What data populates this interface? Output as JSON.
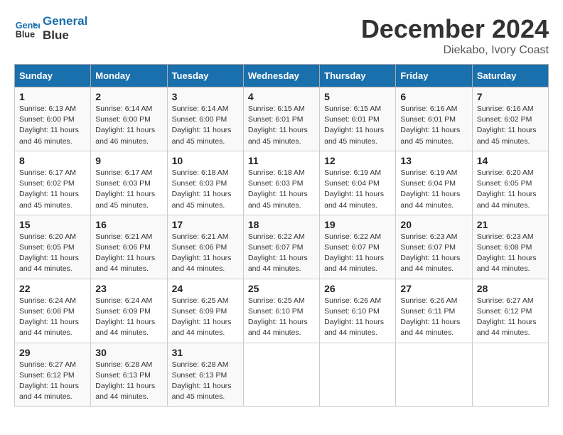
{
  "header": {
    "logo_line1": "General",
    "logo_line2": "Blue",
    "main_title": "December 2024",
    "subtitle": "Diekabo, Ivory Coast"
  },
  "days_of_week": [
    "Sunday",
    "Monday",
    "Tuesday",
    "Wednesday",
    "Thursday",
    "Friday",
    "Saturday"
  ],
  "weeks": [
    [
      {
        "day": "1",
        "info": "Sunrise: 6:13 AM\nSunset: 6:00 PM\nDaylight: 11 hours\nand 46 minutes."
      },
      {
        "day": "2",
        "info": "Sunrise: 6:14 AM\nSunset: 6:00 PM\nDaylight: 11 hours\nand 46 minutes."
      },
      {
        "day": "3",
        "info": "Sunrise: 6:14 AM\nSunset: 6:00 PM\nDaylight: 11 hours\nand 45 minutes."
      },
      {
        "day": "4",
        "info": "Sunrise: 6:15 AM\nSunset: 6:01 PM\nDaylight: 11 hours\nand 45 minutes."
      },
      {
        "day": "5",
        "info": "Sunrise: 6:15 AM\nSunset: 6:01 PM\nDaylight: 11 hours\nand 45 minutes."
      },
      {
        "day": "6",
        "info": "Sunrise: 6:16 AM\nSunset: 6:01 PM\nDaylight: 11 hours\nand 45 minutes."
      },
      {
        "day": "7",
        "info": "Sunrise: 6:16 AM\nSunset: 6:02 PM\nDaylight: 11 hours\nand 45 minutes."
      }
    ],
    [
      {
        "day": "8",
        "info": "Sunrise: 6:17 AM\nSunset: 6:02 PM\nDaylight: 11 hours\nand 45 minutes."
      },
      {
        "day": "9",
        "info": "Sunrise: 6:17 AM\nSunset: 6:03 PM\nDaylight: 11 hours\nand 45 minutes."
      },
      {
        "day": "10",
        "info": "Sunrise: 6:18 AM\nSunset: 6:03 PM\nDaylight: 11 hours\nand 45 minutes."
      },
      {
        "day": "11",
        "info": "Sunrise: 6:18 AM\nSunset: 6:03 PM\nDaylight: 11 hours\nand 45 minutes."
      },
      {
        "day": "12",
        "info": "Sunrise: 6:19 AM\nSunset: 6:04 PM\nDaylight: 11 hours\nand 44 minutes."
      },
      {
        "day": "13",
        "info": "Sunrise: 6:19 AM\nSunset: 6:04 PM\nDaylight: 11 hours\nand 44 minutes."
      },
      {
        "day": "14",
        "info": "Sunrise: 6:20 AM\nSunset: 6:05 PM\nDaylight: 11 hours\nand 44 minutes."
      }
    ],
    [
      {
        "day": "15",
        "info": "Sunrise: 6:20 AM\nSunset: 6:05 PM\nDaylight: 11 hours\nand 44 minutes."
      },
      {
        "day": "16",
        "info": "Sunrise: 6:21 AM\nSunset: 6:06 PM\nDaylight: 11 hours\nand 44 minutes."
      },
      {
        "day": "17",
        "info": "Sunrise: 6:21 AM\nSunset: 6:06 PM\nDaylight: 11 hours\nand 44 minutes."
      },
      {
        "day": "18",
        "info": "Sunrise: 6:22 AM\nSunset: 6:07 PM\nDaylight: 11 hours\nand 44 minutes."
      },
      {
        "day": "19",
        "info": "Sunrise: 6:22 AM\nSunset: 6:07 PM\nDaylight: 11 hours\nand 44 minutes."
      },
      {
        "day": "20",
        "info": "Sunrise: 6:23 AM\nSunset: 6:07 PM\nDaylight: 11 hours\nand 44 minutes."
      },
      {
        "day": "21",
        "info": "Sunrise: 6:23 AM\nSunset: 6:08 PM\nDaylight: 11 hours\nand 44 minutes."
      }
    ],
    [
      {
        "day": "22",
        "info": "Sunrise: 6:24 AM\nSunset: 6:08 PM\nDaylight: 11 hours\nand 44 minutes."
      },
      {
        "day": "23",
        "info": "Sunrise: 6:24 AM\nSunset: 6:09 PM\nDaylight: 11 hours\nand 44 minutes."
      },
      {
        "day": "24",
        "info": "Sunrise: 6:25 AM\nSunset: 6:09 PM\nDaylight: 11 hours\nand 44 minutes."
      },
      {
        "day": "25",
        "info": "Sunrise: 6:25 AM\nSunset: 6:10 PM\nDaylight: 11 hours\nand 44 minutes."
      },
      {
        "day": "26",
        "info": "Sunrise: 6:26 AM\nSunset: 6:10 PM\nDaylight: 11 hours\nand 44 minutes."
      },
      {
        "day": "27",
        "info": "Sunrise: 6:26 AM\nSunset: 6:11 PM\nDaylight: 11 hours\nand 44 minutes."
      },
      {
        "day": "28",
        "info": "Sunrise: 6:27 AM\nSunset: 6:12 PM\nDaylight: 11 hours\nand 44 minutes."
      }
    ],
    [
      {
        "day": "29",
        "info": "Sunrise: 6:27 AM\nSunset: 6:12 PM\nDaylight: 11 hours\nand 44 minutes."
      },
      {
        "day": "30",
        "info": "Sunrise: 6:28 AM\nSunset: 6:13 PM\nDaylight: 11 hours\nand 44 minutes."
      },
      {
        "day": "31",
        "info": "Sunrise: 6:28 AM\nSunset: 6:13 PM\nDaylight: 11 hours\nand 45 minutes."
      },
      {
        "day": "",
        "info": ""
      },
      {
        "day": "",
        "info": ""
      },
      {
        "day": "",
        "info": ""
      },
      {
        "day": "",
        "info": ""
      }
    ]
  ]
}
